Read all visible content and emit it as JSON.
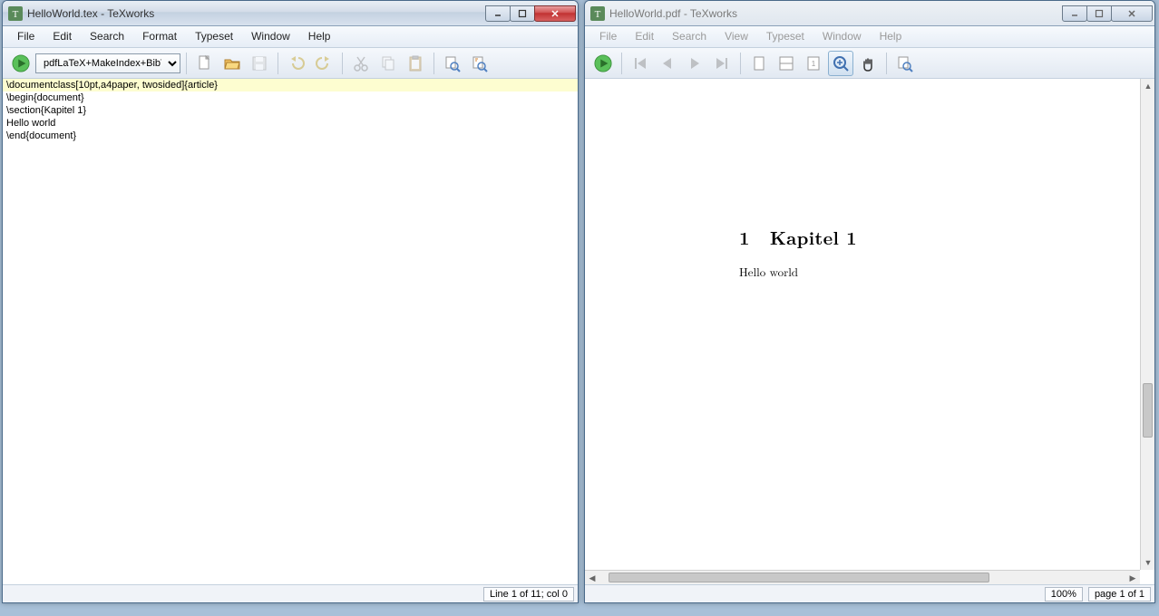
{
  "left_window": {
    "title": "HelloWorld.tex - TeXworks",
    "menu": [
      "File",
      "Edit",
      "Search",
      "Format",
      "Typeset",
      "Window",
      "Help"
    ],
    "typeset_engine": "pdfLaTeX+MakeIndex+BibTeX",
    "editor_lines": [
      "\\documentclass[10pt,a4paper, twosided]{article}",
      "",
      "\\begin{document}",
      "",
      "\\section{Kapitel 1}",
      "Hello world",
      "",
      "\\end{document}"
    ],
    "status": "Line 1 of 11; col 0"
  },
  "right_window": {
    "title": "HelloWorld.pdf - TeXworks",
    "menu": [
      "File",
      "Edit",
      "Search",
      "View",
      "Typeset",
      "Window",
      "Help"
    ],
    "section_number": "1",
    "section_title": "Kapitel 1",
    "body_text": "Hello world",
    "zoom": "100%",
    "page_status": "page 1 of 1"
  },
  "icons": {
    "new": "new-document-icon",
    "open": "open-folder-icon",
    "save": "save-icon",
    "undo": "undo-icon",
    "redo": "redo-icon",
    "cut": "cut-icon",
    "copy": "copy-icon",
    "paste": "paste-icon",
    "find": "find-icon",
    "replace": "replace-icon"
  }
}
